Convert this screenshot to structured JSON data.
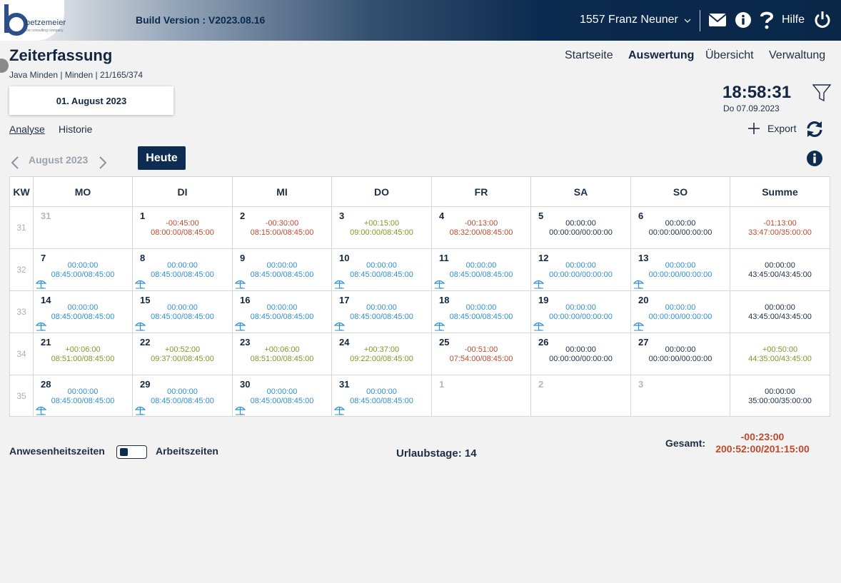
{
  "topbar": {
    "logo_text": "betzemeier",
    "logo_sub": "the consulting company",
    "build_version": "Build Version : V2023.08.16",
    "user": "1557 Franz Neuner",
    "help_label": "Hilfe",
    "icons": [
      "chevron-down-icon",
      "mail-icon",
      "info-icon",
      "help-icon",
      "power-icon"
    ]
  },
  "header": {
    "title": "Zeiterfassung",
    "subtitle": "Java Minden | Minden | 21/165/374",
    "nav": [
      "Startseite",
      "Auswertung",
      "Übersicht",
      "Verwaltung"
    ],
    "active_nav": "Auswertung",
    "selected_date": "01. August 2023",
    "clock_time": "18:58:31",
    "clock_date": "Do 07.09.2023",
    "tabs": [
      "Analyse",
      "Historie"
    ],
    "active_tab": "Analyse",
    "export_label": "Export"
  },
  "month_nav": {
    "label": "August 2023",
    "today_button": "Heute"
  },
  "calendar": {
    "headers": [
      "KW",
      "MO",
      "DI",
      "MI",
      "DO",
      "FR",
      "SA",
      "SO",
      "Summe"
    ],
    "colors": {
      "red": "#c0492c",
      "green": "#7a9a26",
      "blue": "#2f8fd3",
      "black": "#1e2e44"
    },
    "weeks": [
      {
        "kw": "31",
        "days": [
          {
            "num": "31",
            "muted": true,
            "diff": "",
            "total": "",
            "color": "black",
            "vacation": false
          },
          {
            "num": "1",
            "muted": false,
            "diff": "-00:45:00",
            "total": "08:00:00/08:45:00",
            "color": "red",
            "vacation": false
          },
          {
            "num": "2",
            "muted": false,
            "diff": "-00:30:00",
            "total": "08:15:00/08:45:00",
            "color": "red",
            "vacation": false
          },
          {
            "num": "3",
            "muted": false,
            "diff": "+00:15:00",
            "total": "09:00:00/08:45:00",
            "color": "green",
            "vacation": false
          },
          {
            "num": "4",
            "muted": false,
            "diff": "-00:13:00",
            "total": "08:32:00/08:45:00",
            "color": "red",
            "vacation": false
          },
          {
            "num": "5",
            "muted": false,
            "diff": "00:00:00",
            "total": "00:00:00/00:00:00",
            "color": "black",
            "vacation": false
          },
          {
            "num": "6",
            "muted": false,
            "diff": "00:00:00",
            "total": "00:00:00/00:00:00",
            "color": "black",
            "vacation": false
          }
        ],
        "sum": {
          "diff": "-01:13:00",
          "total": "33:47:00/35:00:00",
          "color": "red"
        }
      },
      {
        "kw": "32",
        "days": [
          {
            "num": "7",
            "muted": false,
            "diff": "00:00:00",
            "total": "08:45:00/08:45:00",
            "color": "blue",
            "vacation": true
          },
          {
            "num": "8",
            "muted": false,
            "diff": "00:00:00",
            "total": "08:45:00/08:45:00",
            "color": "blue",
            "vacation": true
          },
          {
            "num": "9",
            "muted": false,
            "diff": "00:00:00",
            "total": "08:45:00/08:45:00",
            "color": "blue",
            "vacation": true
          },
          {
            "num": "10",
            "muted": false,
            "diff": "00:00:00",
            "total": "08:45:00/08:45:00",
            "color": "blue",
            "vacation": true
          },
          {
            "num": "11",
            "muted": false,
            "diff": "00:00:00",
            "total": "08:45:00/08:45:00",
            "color": "blue",
            "vacation": true
          },
          {
            "num": "12",
            "muted": false,
            "diff": "00:00:00",
            "total": "00:00:00/00:00:00",
            "color": "blue",
            "vacation": true
          },
          {
            "num": "13",
            "muted": false,
            "diff": "00:00:00",
            "total": "00:00:00/00:00:00",
            "color": "blue",
            "vacation": true
          }
        ],
        "sum": {
          "diff": "00:00:00",
          "total": "43:45:00/43:45:00",
          "color": "black"
        }
      },
      {
        "kw": "33",
        "days": [
          {
            "num": "14",
            "muted": false,
            "diff": "00:00:00",
            "total": "08:45:00/08:45:00",
            "color": "blue",
            "vacation": true
          },
          {
            "num": "15",
            "muted": false,
            "diff": "00:00:00",
            "total": "08:45:00/08:45:00",
            "color": "blue",
            "vacation": true
          },
          {
            "num": "16",
            "muted": false,
            "diff": "00:00:00",
            "total": "08:45:00/08:45:00",
            "color": "blue",
            "vacation": true
          },
          {
            "num": "17",
            "muted": false,
            "diff": "00:00:00",
            "total": "08:45:00/08:45:00",
            "color": "blue",
            "vacation": true
          },
          {
            "num": "18",
            "muted": false,
            "diff": "00:00:00",
            "total": "08:45:00/08:45:00",
            "color": "blue",
            "vacation": true
          },
          {
            "num": "19",
            "muted": false,
            "diff": "00:00:00",
            "total": "00:00:00/00:00:00",
            "color": "blue",
            "vacation": true
          },
          {
            "num": "20",
            "muted": false,
            "diff": "00:00:00",
            "total": "00:00:00/00:00:00",
            "color": "blue",
            "vacation": true
          }
        ],
        "sum": {
          "diff": "00:00:00",
          "total": "43:45:00/43:45:00",
          "color": "black"
        }
      },
      {
        "kw": "34",
        "days": [
          {
            "num": "21",
            "muted": false,
            "diff": "+00:06:00",
            "total": "08:51:00/08:45:00",
            "color": "green",
            "vacation": false
          },
          {
            "num": "22",
            "muted": false,
            "diff": "+00:52:00",
            "total": "09:37:00/08:45:00",
            "color": "green",
            "vacation": false
          },
          {
            "num": "23",
            "muted": false,
            "diff": "+00:06:00",
            "total": "08:51:00/08:45:00",
            "color": "green",
            "vacation": false
          },
          {
            "num": "24",
            "muted": false,
            "diff": "+00:37:00",
            "total": "09:22:00/08:45:00",
            "color": "green",
            "vacation": false
          },
          {
            "num": "25",
            "muted": false,
            "diff": "-00:51:00",
            "total": "07:54:00/08:45:00",
            "color": "red",
            "vacation": false
          },
          {
            "num": "26",
            "muted": false,
            "diff": "00:00:00",
            "total": "00:00:00/00:00:00",
            "color": "black",
            "vacation": false
          },
          {
            "num": "27",
            "muted": false,
            "diff": "00:00:00",
            "total": "00:00:00/00:00:00",
            "color": "black",
            "vacation": false
          }
        ],
        "sum": {
          "diff": "+00:50:00",
          "total": "44:35:00/43:45:00",
          "color": "green"
        }
      },
      {
        "kw": "35",
        "days": [
          {
            "num": "28",
            "muted": false,
            "diff": "00:00:00",
            "total": "08:45:00/08:45:00",
            "color": "blue",
            "vacation": true
          },
          {
            "num": "29",
            "muted": false,
            "diff": "00:00:00",
            "total": "08:45:00/08:45:00",
            "color": "blue",
            "vacation": true
          },
          {
            "num": "30",
            "muted": false,
            "diff": "00:00:00",
            "total": "08:45:00/08:45:00",
            "color": "blue",
            "vacation": true
          },
          {
            "num": "31",
            "muted": false,
            "diff": "00:00:00",
            "total": "08:45:00/08:45:00",
            "color": "blue",
            "vacation": true
          },
          {
            "num": "1",
            "muted": true,
            "diff": "",
            "total": "",
            "color": "black",
            "vacation": false
          },
          {
            "num": "2",
            "muted": true,
            "diff": "",
            "total": "",
            "color": "black",
            "vacation": false
          },
          {
            "num": "3",
            "muted": true,
            "diff": "",
            "total": "",
            "color": "black",
            "vacation": false
          }
        ],
        "sum": {
          "diff": "00:00:00",
          "total": "35:00:00/35:00:00",
          "color": "black"
        }
      }
    ]
  },
  "footer": {
    "toggle_left": "Anwesenheitszeiten",
    "toggle_right": "Arbeitszeiten",
    "vacation_days": "Urlaubstage: 14",
    "total_label": "Gesamt:",
    "total_diff": "-00:23:00",
    "total_value": "200:52:00/201:15:00"
  }
}
